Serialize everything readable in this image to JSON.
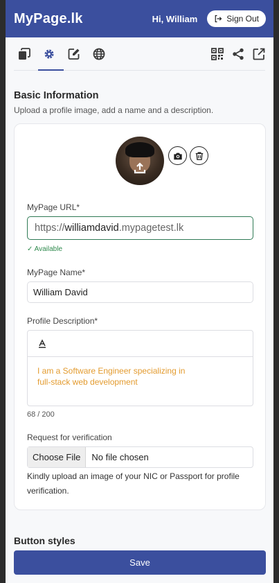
{
  "header": {
    "brand": "MyPage.lk",
    "greeting": "Hi, William",
    "sign_out_label": "Sign Out"
  },
  "toolbar": {
    "left_icons": [
      "pages-icon",
      "settings-icon",
      "edit-icon",
      "globe-icon"
    ],
    "right_icons": [
      "qr-code-icon",
      "share-icon",
      "external-link-icon"
    ],
    "active_tab": "settings-icon"
  },
  "section": {
    "title": "Basic Information",
    "subtitle": "Upload a profile image, add a name and a description."
  },
  "form": {
    "url_label": "MyPage URL*",
    "url_prefix": "https://",
    "url_username": "williamdavid",
    "url_suffix": ".mypagetest.lk",
    "url_status": "✓ Available",
    "name_label": "MyPage Name*",
    "name_value": "William David",
    "description_label": "Profile Description*",
    "description_value": "I am a Software Engineer specializing in full-stack web development",
    "description_counter": "68 / 200",
    "verification_label": "Request for verification",
    "choose_file_label": "Choose File",
    "file_status": "No file chosen",
    "verification_help": "Kindly upload an image of your NIC or Passport for profile verification."
  },
  "next_section_title": "Button styles",
  "save_label": "Save",
  "colors": {
    "brand": "#3b4f9e",
    "available": "#2f8a4d",
    "description_text": "#e39b2f"
  }
}
